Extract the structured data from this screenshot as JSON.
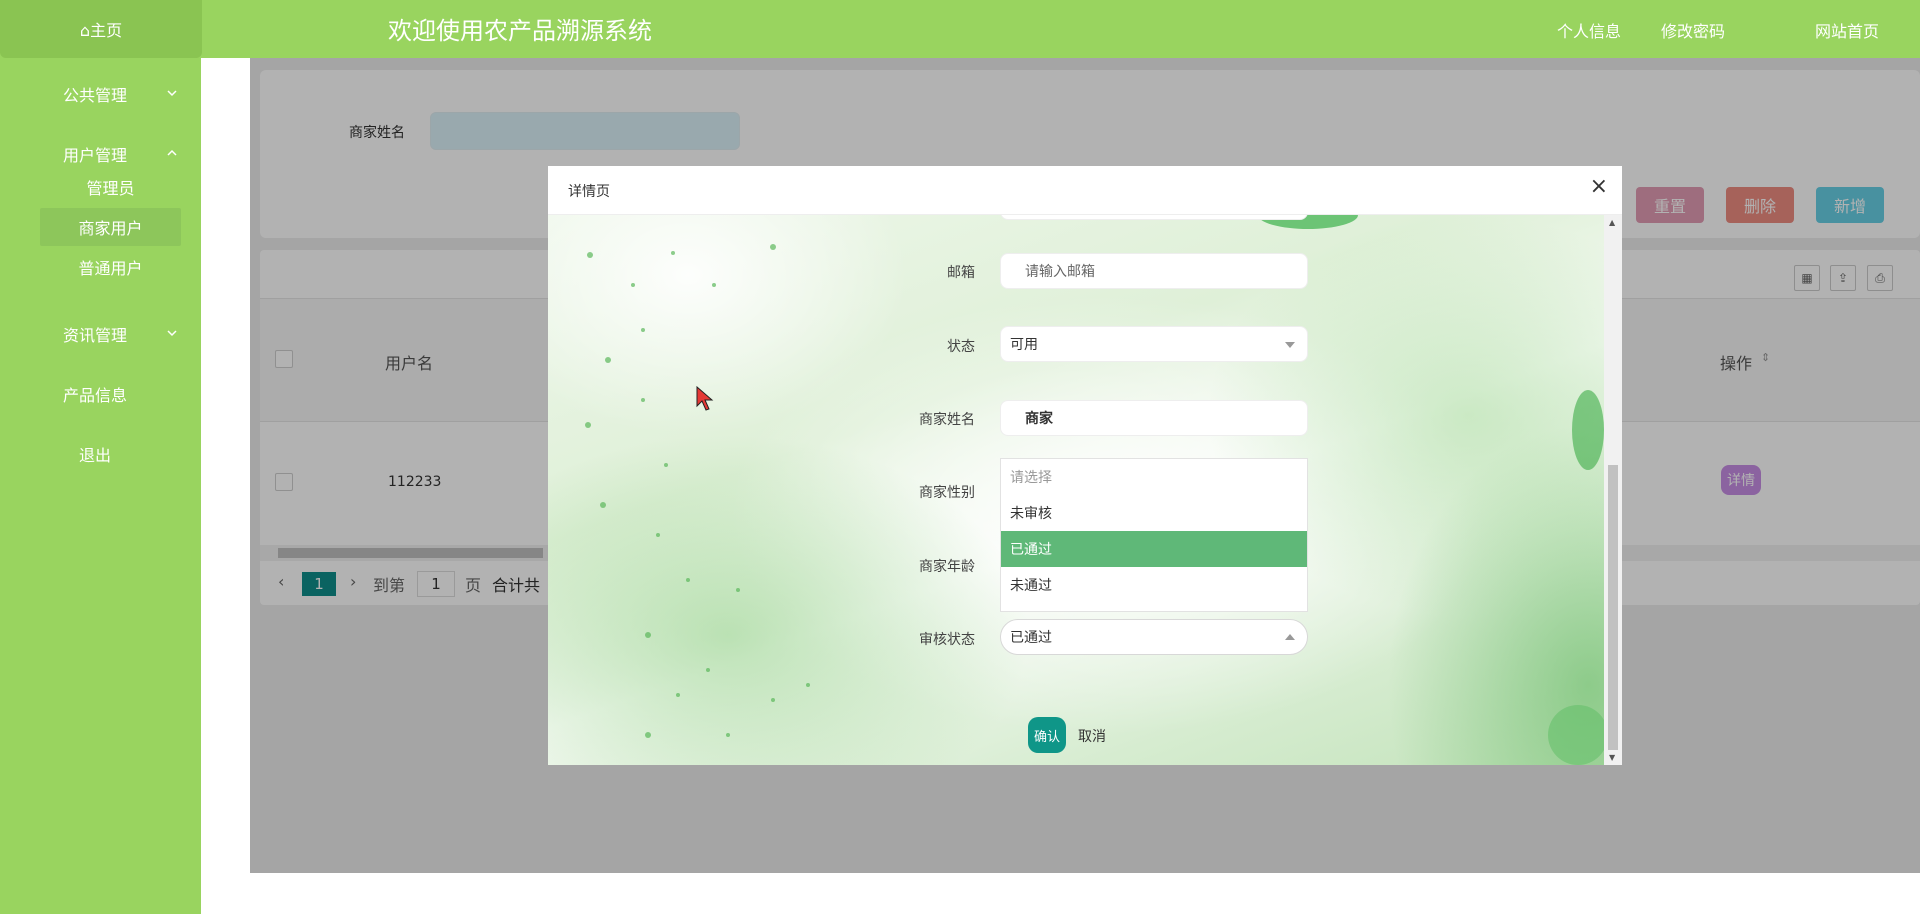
{
  "header": {
    "home": "⌂主页",
    "title": "欢迎使用农产品溯源系统",
    "links": [
      "个人信息",
      "修改密码",
      "网站首页"
    ]
  },
  "sidebar": {
    "menus": [
      {
        "label": "公共管理",
        "chevron": "down"
      },
      {
        "label": "用户管理",
        "chevron": "up"
      },
      {
        "label": "资讯管理",
        "chevron": "down"
      },
      {
        "label": "产品信息"
      },
      {
        "label": "退出"
      }
    ],
    "user_sub": [
      "管理员",
      "商家用户",
      "普通用户"
    ],
    "active_sub": "商家用户"
  },
  "search": {
    "label": "商家姓名"
  },
  "toolbar": {
    "reset": "重置",
    "delete": "删除",
    "add": "新增"
  },
  "table": {
    "columns": [
      "用户名",
      "操作"
    ],
    "rows": [
      {
        "username": "112233",
        "action": "详情"
      }
    ]
  },
  "pager": {
    "current_page": "1",
    "goto_prefix": "到第",
    "goto_value": "1",
    "goto_suffix": "页",
    "total_prefix": "合计共"
  },
  "modal": {
    "title": "详情页",
    "close": "×",
    "fields": {
      "email_label": "邮箱",
      "email_placeholder": "请输入邮箱",
      "status_label": "状态",
      "status_value": "可用",
      "name_label": "商家姓名",
      "name_value": "商家",
      "gender_label": "商家性别",
      "age_label": "商家年龄",
      "audit_label": "审核状态",
      "audit_value": "已通过"
    },
    "dropdown": {
      "options": [
        "请选择",
        "未审核",
        "已通过",
        "未通过"
      ],
      "selected": "已通过"
    },
    "confirm": "确认",
    "cancel": "取消"
  },
  "colors": {
    "theme_green": "#99d45f",
    "selected_option": "#5fb878",
    "confirm_button": "#0f9688",
    "reset_button": "#e29db5",
    "delete_button": "#ee8d82",
    "add_button": "#67d0e6",
    "detail_button": "#c88ee5"
  }
}
